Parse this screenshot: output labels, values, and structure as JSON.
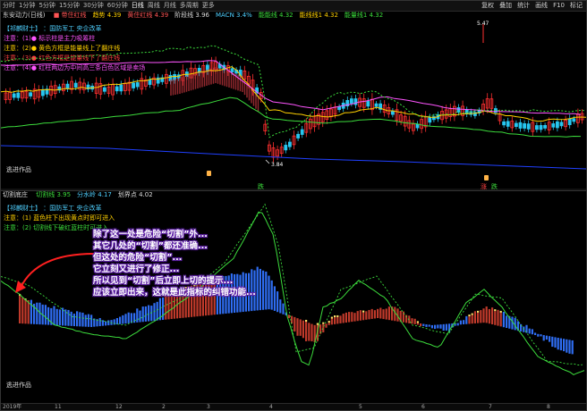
{
  "topbar": {
    "periods": [
      "分时",
      "1分钟",
      "5分钟",
      "15分钟",
      "30分钟",
      "60分钟",
      "日线",
      "周线",
      "月线",
      "多周期",
      "更多"
    ],
    "selected_period": "日线",
    "menu": [
      "复权",
      "叠加",
      "统计",
      "画线",
      "F10",
      "标记"
    ]
  },
  "main_panel": {
    "stock_label": "东安动力(日线)",
    "legend": [
      {
        "text": "■ 带住红线",
        "color": "#ff5555"
      },
      {
        "text": "趋势 4.39",
        "color": "#ffd000"
      },
      {
        "text": "黄住红线 4.39",
        "color": "#ff5555"
      },
      {
        "text": "阶段线 3.96",
        "color": "#dddddd"
      },
      {
        "text": "MACN 3.4%",
        "color": "#4fd0ff"
      },
      {
        "text": "能能线 4.32",
        "color": "#3cdc3c"
      },
      {
        "text": "能线线1 4.32",
        "color": "#ffd000"
      },
      {
        "text": "能量线1 4.32",
        "color": "#3cdc3c"
      }
    ],
    "notes": [
      {
        "text": "【祁麟财士】 ：国防军工 央企改革",
        "color": "#4fd0ff"
      },
      {
        "text": "注意：(1)● 标示柱是主力吸筹柱",
        "color": "#ff55ff"
      },
      {
        "text": "注意：(2)● 黄色方框是能量线上了翻庄线",
        "color": "#ffd000"
      },
      {
        "text": "注意：(3)● 红色方框是能量线下了翻庄线",
        "color": "#ff4040"
      },
      {
        "text": "注意：(4)● 红柱两边为中间高三条白色区域是卖场",
        "color": "#ff55ff"
      }
    ],
    "high_label": "5.47",
    "low_label": "3.84",
    "footer_label": "逃进作品",
    "markers": [
      "跌",
      "涨",
      "跌"
    ]
  },
  "sub_panel": {
    "title": "切割底庄",
    "legend": [
      {
        "text": "切割线 3.95",
        "color": "#3cdc3c"
      },
      {
        "text": "分水岭 4.17",
        "color": "#4fd0ff"
      },
      {
        "text": "划界点 4.02",
        "color": "#dddddd"
      }
    ],
    "notes": [
      {
        "text": "【祁麟财士】 ：国防军工 央企改革",
        "color": "#4fd0ff"
      },
      {
        "text": "注意：(1) 蓝色柱下出现黄点时即可进入",
        "color": "#ffd000"
      },
      {
        "text": "注意：(2) 切割线下破红蓝柱时可进入",
        "color": "#3cdc3c"
      }
    ],
    "footer_label": "逃进作品",
    "callout": [
      "除了这一处是危险“切割”外...",
      "其它几处的“切割”都还准确...",
      "但这处的危险“切割”...",
      "它立刻又进行了修正...",
      "所以见到“切割”后立即上切的提示...",
      "应该立即出来，这就是此指标的纠错功能..."
    ]
  },
  "bottombar": {
    "labels": [
      "2019年",
      "11",
      "12",
      "2",
      "3",
      "4",
      "5",
      "6",
      "7",
      "8"
    ]
  },
  "colors": {
    "background": "#000000",
    "candle_up": "#ff3030",
    "candle_down": "#26c6f0",
    "ma_fast": "#ffd000",
    "ma_mid": "#ff55ff",
    "ma_slow": "#3cdc3c",
    "ma_long": "#2040ff",
    "bar_red": "#c03a2b",
    "bar_blue": "#2f6df2",
    "callout_glow": "#6a2ab5",
    "arrow": "#ff2020"
  }
}
